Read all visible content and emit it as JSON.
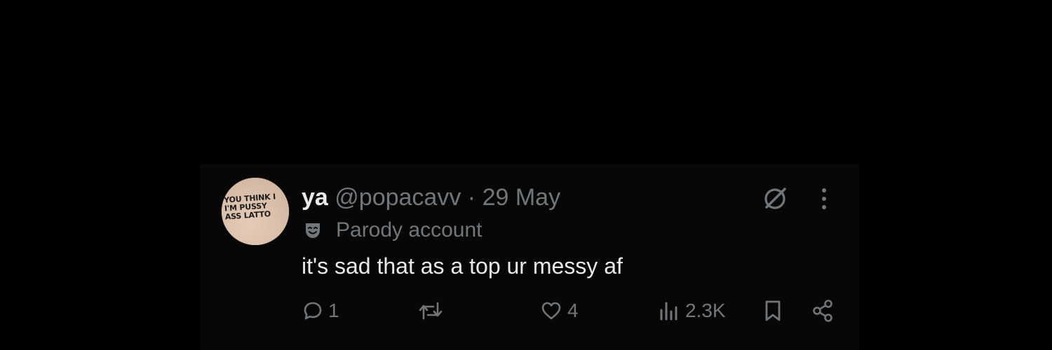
{
  "tweet": {
    "author": {
      "name": "ya",
      "handle": "@popacavv",
      "separator": "·",
      "date": "29 May",
      "avatar_text": "YOU THINK I\nI'M PUSSY\nASS LATTO"
    },
    "label": {
      "icon": "parody-mask-icon",
      "text": "Parody account"
    },
    "text": "it's sad that as a top ur messy af",
    "actions": {
      "reply": {
        "icon": "reply-icon",
        "count": "1"
      },
      "retweet": {
        "icon": "retweet-icon",
        "count": ""
      },
      "like": {
        "icon": "heart-icon",
        "count": "4"
      },
      "views": {
        "icon": "views-chart-icon",
        "count": "2.3K"
      },
      "bookmark": {
        "icon": "bookmark-icon"
      },
      "share": {
        "icon": "share-icon"
      }
    },
    "top_icons": [
      "grok-icon",
      "more-icon"
    ]
  },
  "colors": {
    "background": "#000000",
    "card": "#070707",
    "primary_text": "#e7e9ea",
    "secondary_text": "#71767b"
  }
}
